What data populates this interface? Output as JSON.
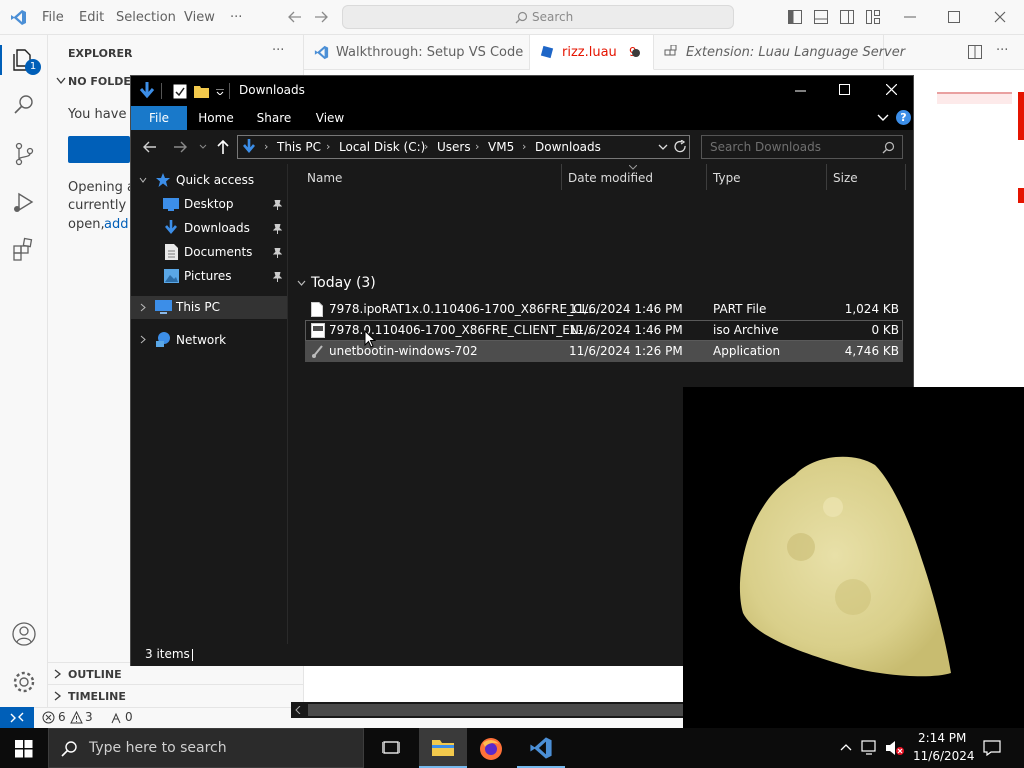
{
  "vscode": {
    "menu": [
      "File",
      "Edit",
      "Selection",
      "View",
      "···"
    ],
    "search_placeholder": "Search",
    "sidebar": {
      "title": "EXPLORER",
      "section": "NO FOLDER",
      "text1": "You have n",
      "text2_lines": [
        "Opening a",
        "currently o"
      ],
      "text3": "open,",
      "add_link": "add",
      "outline": "OUTLINE",
      "timeline": "TIMELINE"
    },
    "activity_badge": "1",
    "tabs": [
      {
        "label": "Walkthrough: Setup VS Code"
      },
      {
        "label": "rizz.luau",
        "count": "9"
      },
      {
        "label": "Extension: Luau Language Server"
      }
    ],
    "status": {
      "errors": "6",
      "warnings": "3",
      "ports": "0"
    }
  },
  "explorer": {
    "title": "Downloads",
    "ribbon": [
      "File",
      "Home",
      "Share",
      "View"
    ],
    "breadcrumb": [
      "This PC",
      "Local Disk (C:)",
      "Users",
      "VM5",
      "Downloads"
    ],
    "search_placeholder": "Search Downloads",
    "nav": {
      "quick_access": "Quick access",
      "items": [
        "Desktop",
        "Downloads",
        "Documents",
        "Pictures"
      ],
      "this_pc": "This PC",
      "network": "Network"
    },
    "columns": [
      "Name",
      "Date modified",
      "Type",
      "Size"
    ],
    "group": "Today (3)",
    "files": [
      {
        "name": "7978.ipoRAT1x.0.110406-1700_X86FRE_CL...",
        "date": "11/6/2024 1:46 PM",
        "type": "PART File",
        "size": "1,024 KB"
      },
      {
        "name": "7978.0.110406-1700_X86FRE_CLIENT_EN-...",
        "date": "11/6/2024 1:46 PM",
        "type": "iso Archive",
        "size": "0 KB"
      },
      {
        "name": "unetbootin-windows-702",
        "date": "11/6/2024 1:26 PM",
        "type": "Application",
        "size": "4,746 KB"
      }
    ],
    "status": "3 items"
  },
  "taskbar": {
    "search_placeholder": "Type here to search",
    "time": "2:14 PM",
    "date": "11/6/2024"
  },
  "colors": {
    "vscode_blue": "#005fb8",
    "status_remote": "#005fb8",
    "folder_yellow": "#f2c94c",
    "win_blue": "#3c8ee8",
    "tab_dirty": "#3b3b3b",
    "error_red": "#e51400"
  }
}
